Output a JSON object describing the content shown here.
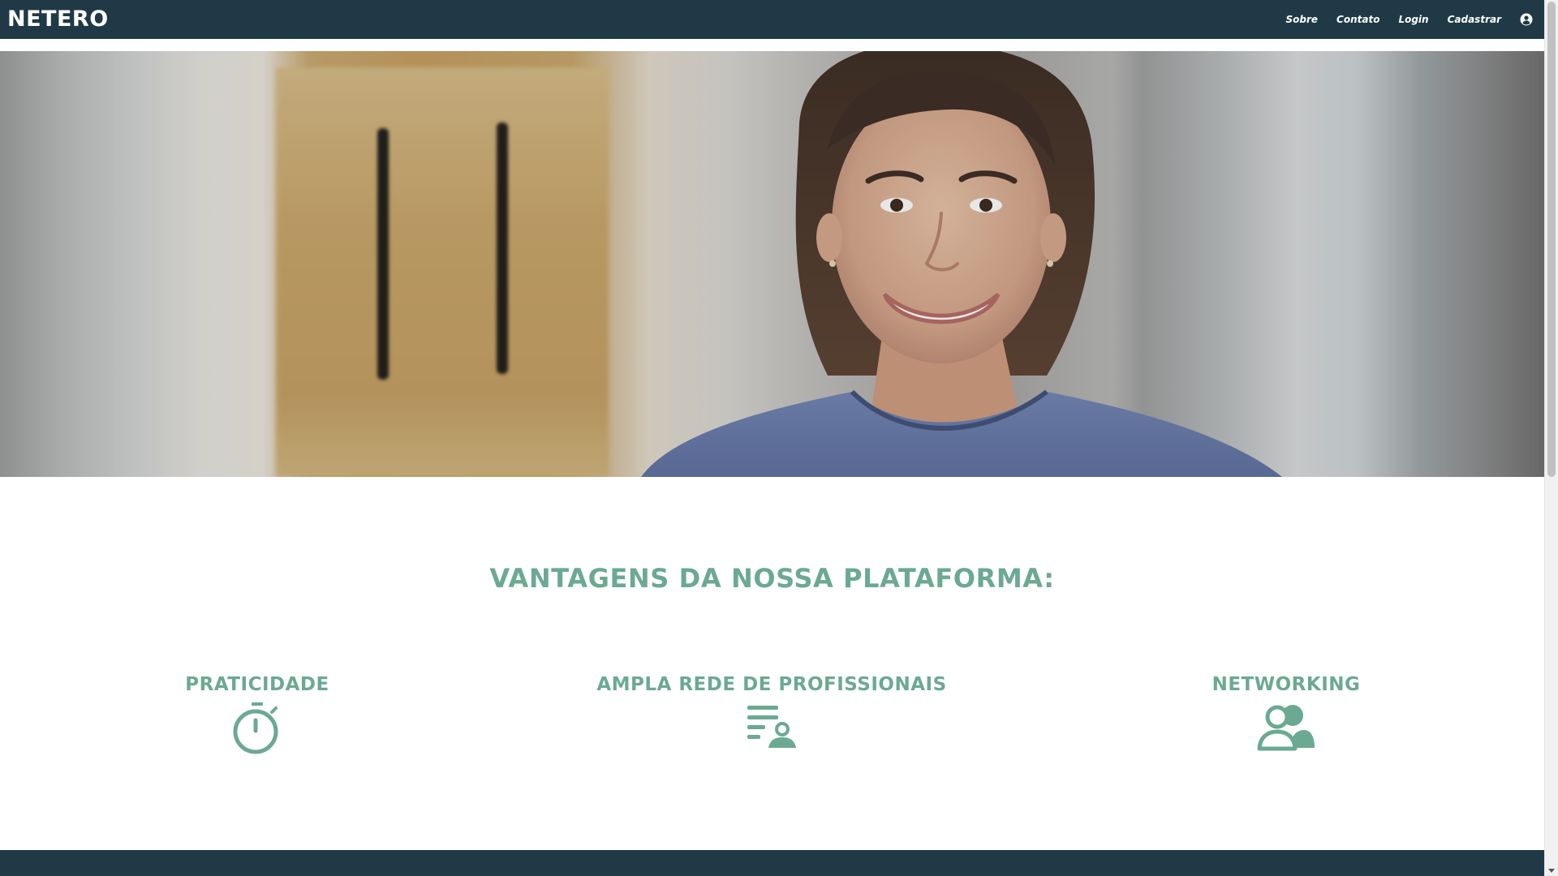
{
  "header": {
    "brand": "NETERO",
    "nav": [
      "Sobre",
      "Contato",
      "Login",
      "Cadastrar"
    ],
    "user_icon": "user-circle-icon"
  },
  "hero": {
    "image": "smiling-healthcare-professional-photo"
  },
  "advantages": {
    "title": "VANTAGENS DA NOSSA PLATAFORMA:",
    "features": [
      {
        "title": "PRATICIDADE",
        "icon": "stopwatch-icon"
      },
      {
        "title": "AMPLA REDE DE PROFISSIONAIS",
        "icon": "list-person-icon"
      },
      {
        "title": "NETWORKING",
        "icon": "users-icon"
      }
    ]
  },
  "colors": {
    "navbar_bg": "#1f3a46",
    "accent_green": "#6ba992",
    "footer_bg": "#1f3a46"
  }
}
